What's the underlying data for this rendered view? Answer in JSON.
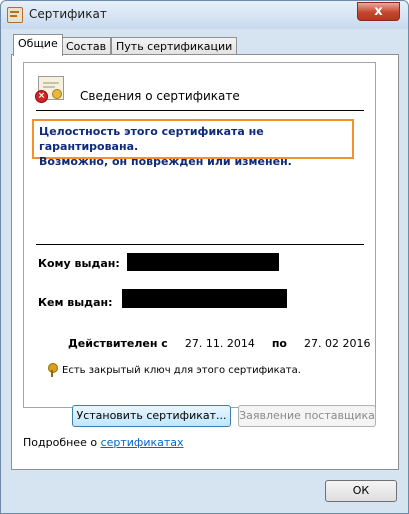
{
  "window": {
    "title": "Сертификат",
    "close_glyph": "x"
  },
  "tabs": [
    "Общие",
    "Состав",
    "Путь сертификации"
  ],
  "info": {
    "heading": "Сведения о сертификате",
    "warning_line1": "Целостность этого сертификата не гарантирована.",
    "warning_line2": "Возможно, он поврежден или изменен.",
    "issued_to_label": "Кому выдан:",
    "issued_by_label": "Кем выдан:",
    "valid_from_label": "Действителен с",
    "valid_from": "27. 11. 2014",
    "valid_to_label": "по",
    "valid_to": "27. 02  2016",
    "private_key_note": "Есть закрытый ключ для этого сертификата."
  },
  "buttons": {
    "install": "Установить сертификат...",
    "issuer_statement": "Заявление поставщика",
    "ok": "ОК"
  },
  "footer": {
    "more_prefix": "Подробнее о ",
    "more_link": "сертификатах"
  },
  "colors": {
    "warning_border": "#f39229",
    "warning_text": "#0e2a7a",
    "link": "#0066cc"
  }
}
